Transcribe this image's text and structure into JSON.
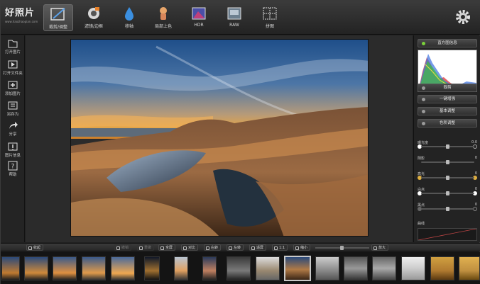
{
  "app": {
    "name": "好照片",
    "url": "www.haozhaopian.com"
  },
  "toolbar": [
    {
      "label": "裁剪/调整",
      "icon": "crop-adjust-icon"
    },
    {
      "label": "滤镜/边框",
      "icon": "filter-frame-icon"
    },
    {
      "label": "移轴",
      "icon": "tilt-shift-icon"
    },
    {
      "label": "局部上色",
      "icon": "partial-color-icon"
    },
    {
      "label": "HDR",
      "icon": "hdr-icon"
    },
    {
      "label": "RAW",
      "icon": "raw-icon"
    },
    {
      "label": "拼图",
      "icon": "collage-icon"
    }
  ],
  "sidebar": [
    {
      "label": "打开图片",
      "icon": "open-image-icon"
    },
    {
      "label": "打开文件夹",
      "icon": "open-folder-icon"
    },
    {
      "label": "添加图片",
      "icon": "add-image-icon"
    },
    {
      "label": "另存为",
      "icon": "save-as-icon"
    },
    {
      "label": "分享",
      "icon": "share-icon"
    },
    {
      "label": "图片信息",
      "icon": "image-info-icon"
    },
    {
      "label": "帮助",
      "icon": "help-icon"
    }
  ],
  "panel": {
    "histogram_label": "直方图信息",
    "buttons": [
      "裁剪",
      "一键增强",
      "基本调整",
      "色阶调整"
    ],
    "sliders": [
      {
        "label": "曝光度",
        "value": "0.0"
      },
      {
        "label": "阴影",
        "value": "0"
      },
      {
        "label": "高光",
        "value": "0"
      },
      {
        "label": "白点",
        "value": "0"
      },
      {
        "label": "黑点",
        "value": "0"
      }
    ],
    "curve_label": "曲线"
  },
  "bottombar": {
    "collapse": "收起",
    "undo": "撤销",
    "redo": "重做",
    "fullscreen": "全屏",
    "compare": "对比",
    "rotate_right": "右转",
    "rotate_left": "左转",
    "fit": "适屏",
    "actual": "1:1",
    "zoom_out": "缩小",
    "zoom_in": "放大"
  },
  "colors": {
    "accent_active": "#7ad13a",
    "background": "#202020"
  }
}
